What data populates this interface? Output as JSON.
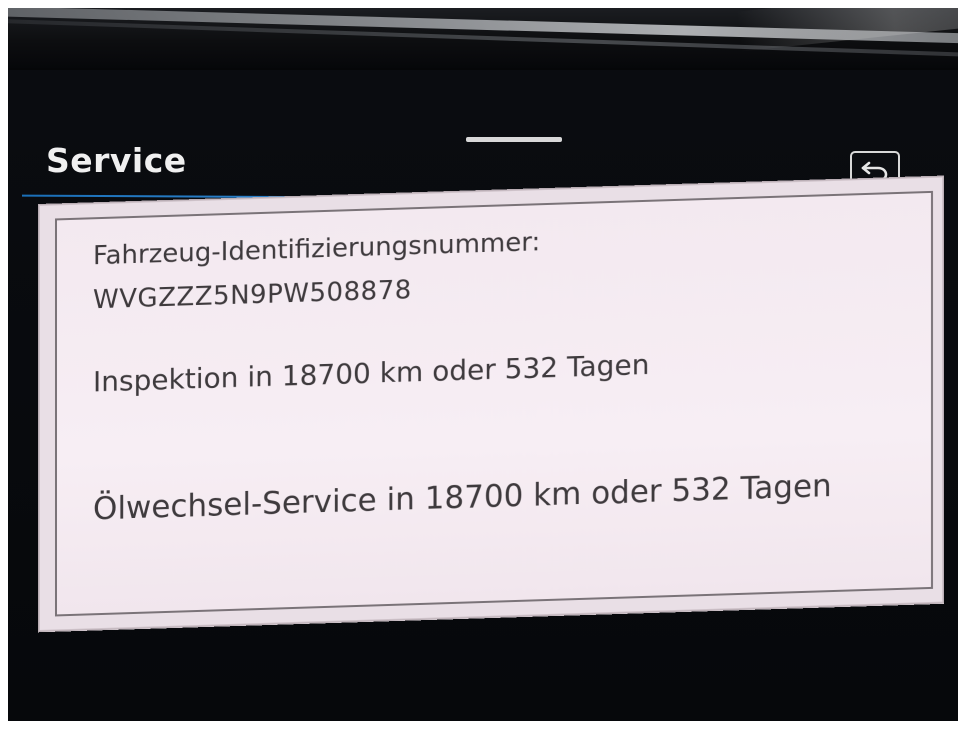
{
  "header": {
    "title": "Service",
    "back_icon": "back-return-icon"
  },
  "service_info": {
    "vin_label": "Fahrzeug-Identifizierungsnummer:",
    "vin_value": "WVGZZZ5N9PW508878",
    "inspection": "Inspektion in 18700 km oder 532 Tagen",
    "oil_change": "Ölwechsel-Service in 18700 km oder 532 Tagen"
  },
  "colors": {
    "screen_background": "#06080b",
    "title_text": "#f0f0f0",
    "accent_rule": "#2a7fc8",
    "panel_background": "#f3e9f0",
    "panel_text": "#3e3a3d"
  }
}
